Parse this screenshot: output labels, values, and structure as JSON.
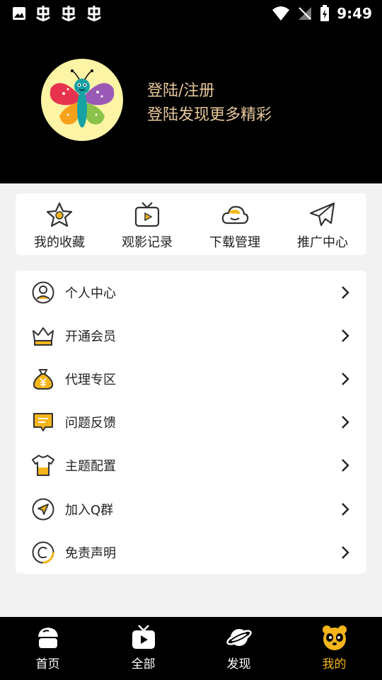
{
  "status": {
    "time": "9:49"
  },
  "profile": {
    "login_title": "登陆/注册",
    "login_subtitle": "登陆发现更多精彩"
  },
  "quick_actions": [
    {
      "label": "我的收藏",
      "icon": "star-icon"
    },
    {
      "label": "观影记录",
      "icon": "tv-play-icon"
    },
    {
      "label": "下载管理",
      "icon": "cloud-icon"
    },
    {
      "label": "推广中心",
      "icon": "paper-plane-icon"
    }
  ],
  "menu": [
    {
      "label": "个人中心",
      "icon": "user-circle-icon"
    },
    {
      "label": "开通会员",
      "icon": "crown-icon"
    },
    {
      "label": "代理专区",
      "icon": "money-bag-icon"
    },
    {
      "label": "问题反馈",
      "icon": "feedback-icon"
    },
    {
      "label": "主题配置",
      "icon": "tshirt-icon"
    },
    {
      "label": "加入Q群",
      "icon": "navigation-icon"
    },
    {
      "label": "免责声明",
      "icon": "copyright-icon"
    }
  ],
  "tabs": [
    {
      "label": "首页",
      "icon": "home-icon",
      "active": false
    },
    {
      "label": "全部",
      "icon": "tv-icon",
      "active": false
    },
    {
      "label": "发现",
      "icon": "planet-icon",
      "active": false
    },
    {
      "label": "我的",
      "icon": "panda-icon",
      "active": true
    }
  ],
  "colors": {
    "accent": "#f5b51b",
    "header_bg": "#000000",
    "login_text": "#e8c89a",
    "page_bg": "#f2f2f2"
  }
}
